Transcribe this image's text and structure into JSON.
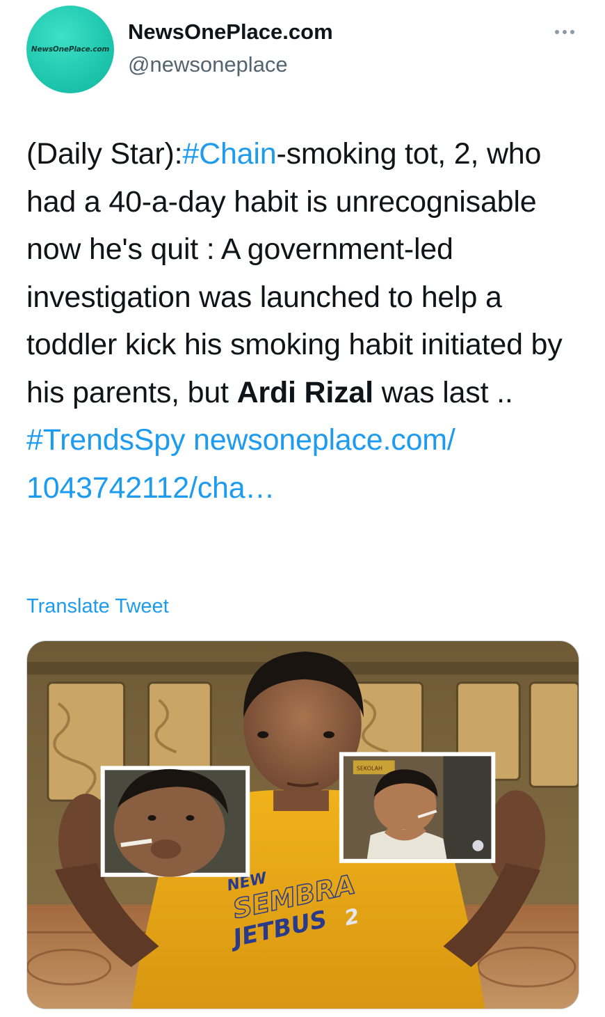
{
  "header": {
    "display_name": "NewsOnePlace.com",
    "handle": "@newsoneplace",
    "avatar_text": "NewsOnePlace.com",
    "more_icon": "ellipsis-icon"
  },
  "tweet": {
    "seg1": "(Daily Star):",
    "hashtag1": "#Chain",
    "seg2": "-smoking tot, 2, who had a 40-a-day habit is unrecognisable now he's quit : A government-led investigation was launched to help a toddler kick his smoking habit initiated by his parents, but ",
    "bold_name": "Ardi Rizal",
    "seg3": " was last .. ",
    "hashtag2": "#TrendsSpy",
    "link": "newsoneplace.com/ 1043742112/cha…"
  },
  "translate_label": "Translate Tweet",
  "media": {
    "shirt_text_1": "NEW",
    "shirt_text_2": "SEMBRA",
    "shirt_text_3": "JETBUS",
    "shirt_text_4": "2",
    "photo_sign": "SEKOLAH"
  },
  "colors": {
    "link": "#1d9bf0",
    "text": "#0f1419",
    "secondary": "#536471",
    "avatar": "#20c9b0"
  }
}
